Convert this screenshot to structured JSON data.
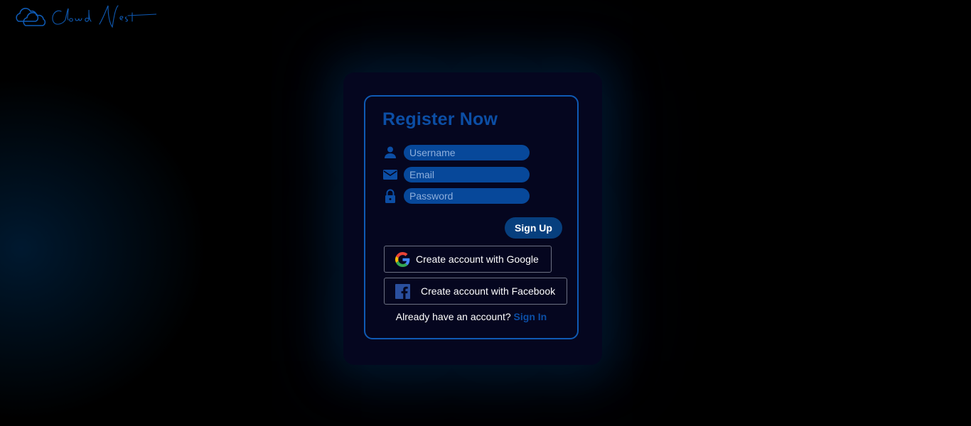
{
  "brand": {
    "logo_text": "CloudNest",
    "logo_color": "#0f5ab4"
  },
  "form": {
    "title": "Register Now",
    "fields": [
      {
        "icon": "user-icon",
        "placeholder": "Username"
      },
      {
        "icon": "mail-icon",
        "placeholder": "Email"
      },
      {
        "icon": "lock-icon",
        "placeholder": "Password"
      }
    ],
    "signup_label": "Sign Up",
    "google_label": "Create account with Google",
    "facebook_label": "Create account with Facebook",
    "have_account_text": "Already have an account?",
    "signin_label": "Sign In"
  },
  "colors": {
    "accent": "#0c4ea5",
    "input_bg": "#07489a",
    "card_bg": "#05061f",
    "page_bg": "#000000"
  }
}
